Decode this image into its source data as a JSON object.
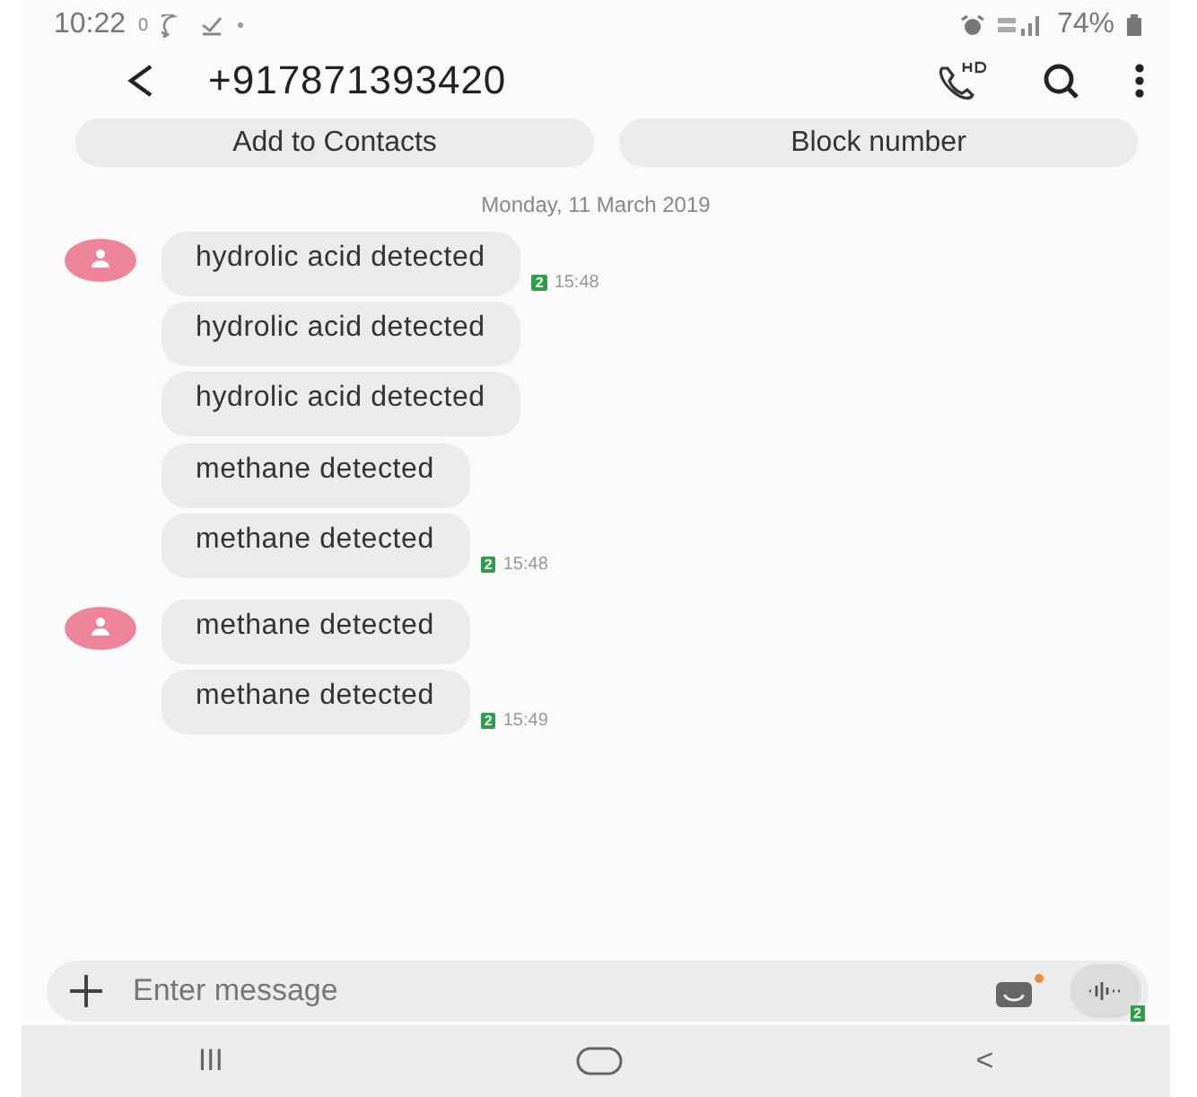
{
  "status_bar": {
    "time": "10:22",
    "net_speed": "0",
    "battery": "74%"
  },
  "header": {
    "phone_number": "+917871393420"
  },
  "actions": [
    "Add to Contacts",
    "Block number"
  ],
  "date": "Monday, 11 March 2019",
  "messages": [
    {
      "text": "hydrolic acid detected",
      "avatar": true,
      "sim": "2",
      "time": "15:48"
    },
    {
      "text": "hydrolic acid detected",
      "avatar": false
    },
    {
      "text": "hydrolic acid detected",
      "avatar": false
    },
    {
      "text": "methane detected",
      "avatar": false
    },
    {
      "text": "methane detected",
      "avatar": false,
      "sim": "2",
      "time": "15:48"
    },
    {
      "text": "methane detected",
      "avatar": true
    },
    {
      "text": "methane detected",
      "avatar": false,
      "sim": "2",
      "time": "15:49"
    }
  ],
  "composer": {
    "placeholder": "Enter message",
    "voice_sim": "2"
  },
  "nav_bar": [
    "III",
    "<"
  ]
}
